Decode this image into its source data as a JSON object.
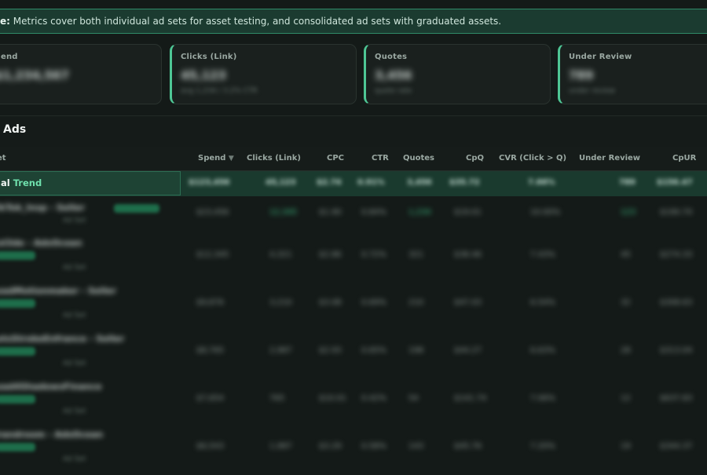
{
  "note": {
    "label": "e:",
    "text": "Metrics cover both individual ad sets for asset testing, and consolidated ad sets with graduated assets."
  },
  "cards": [
    {
      "label": "end",
      "value": "$1,234,567",
      "sub": "total spend to date"
    },
    {
      "label": "Clicks (Link)",
      "value": "45,123",
      "sub": "avg 1,234 / 3.2% CTR"
    },
    {
      "label": "Quotes",
      "value": "3,456",
      "sub": "quote rate"
    },
    {
      "label": "Under Review",
      "value": "789",
      "sub": "under review"
    }
  ],
  "section": {
    "title": "Ads"
  },
  "table": {
    "headers": {
      "name": "et",
      "spend": "Spend",
      "spend_sort": "▼",
      "clicks": "Clicks (Link)",
      "cpc": "CPC",
      "ctr": "CTR",
      "quotes": "Quotes",
      "cpq": "CpQ",
      "cvr": "CVR (Click > Q)",
      "under_review": "Under Review",
      "cpur": "CpUR"
    },
    "total": {
      "label_a": "al",
      "label_b": "Trend",
      "spend": "$123,456",
      "clicks": "45,123",
      "cpc": "$2.74",
      "ctr": "0.91%",
      "quotes": "3,456",
      "cpq": "$35.72",
      "cvr": "7.66%",
      "under_review": "789",
      "cpur": "$156.47"
    },
    "rows": [
      {
        "name": "- TikTok_Insp - Seller",
        "meta": "Ad Set",
        "spend": "$23,456",
        "clicks": "12,345",
        "cpc": "$1.90",
        "ctr": "0.84%",
        "quotes": "1,234",
        "cpq": "$19.01",
        "cvr": "10.00%",
        "under_review": "123",
        "cpur": "$190.70"
      },
      {
        "name": "- Col3de - AdsOcean",
        "meta": "Ad Set",
        "spend": "$12,345",
        "clicks": "4,321",
        "cpc": "$2.86",
        "ctr": "0.72%",
        "quotes": "321",
        "cpq": "$38.46",
        "cvr": "7.43%",
        "under_review": "45",
        "cpur": "$274.33"
      },
      {
        "name": "- LeadMotionmaker - Seller",
        "meta": "Ad Set",
        "spend": "$9,876",
        "clicks": "3,210",
        "cpc": "$3.08",
        "ctr": "0.69%",
        "quotes": "210",
        "cpq": "$47.03",
        "cvr": "6.54%",
        "under_review": "32",
        "cpur": "$308.63"
      },
      {
        "name": "- LetsStrokeEnfrance - Seller",
        "meta": "Ad Set",
        "spend": "$8,765",
        "clicks": "2,987",
        "cpc": "$2.93",
        "ctr": "0.65%",
        "quotes": "198",
        "cpq": "$44.27",
        "cvr": "6.63%",
        "under_review": "28",
        "cpur": "$313.04"
      },
      {
        "name": "- Lead4ShadowsFinance",
        "meta": "Ad Set",
        "spend": "$7,654",
        "clicks": "765",
        "cpc": "$10.01",
        "ctr": "0.42%",
        "quotes": "54",
        "cpq": "$141.74",
        "cvr": "7.06%",
        "under_review": "12",
        "cpur": "$637.83"
      },
      {
        "name": "- Brandroom - AdsOcean",
        "meta": "Ad Set",
        "spend": "$6,543",
        "clicks": "1,987",
        "cpc": "$3.29",
        "ctr": "0.58%",
        "quotes": "143",
        "cpq": "$45.76",
        "cvr": "7.20%",
        "under_review": "19",
        "cpur": "$344.37"
      }
    ]
  }
}
